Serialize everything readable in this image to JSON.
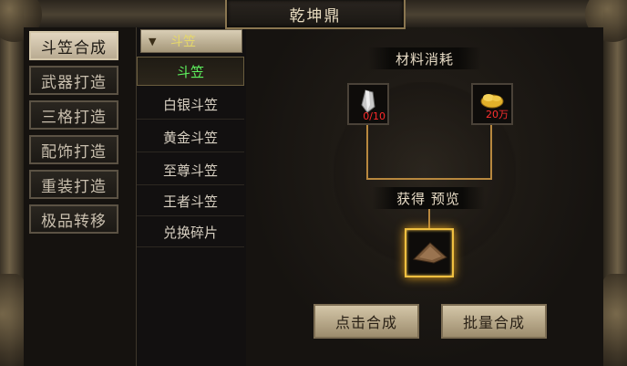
{
  "window": {
    "title": "乾坤鼎"
  },
  "side_tabs": [
    {
      "label": "斗笠合成",
      "active": true
    },
    {
      "label": "武器打造",
      "active": false
    },
    {
      "label": "三格打造",
      "active": false
    },
    {
      "label": "配饰打造",
      "active": false
    },
    {
      "label": "重装打造",
      "active": false
    },
    {
      "label": "极品转移",
      "active": false
    }
  ],
  "list": {
    "header": {
      "arrow": "▼",
      "label": "斗笠"
    },
    "items": [
      {
        "label": "斗笠",
        "selected": true
      },
      {
        "label": "白银斗笠",
        "selected": false
      },
      {
        "label": "黄金斗笠",
        "selected": false
      },
      {
        "label": "至尊斗笠",
        "selected": false
      },
      {
        "label": "王者斗笠",
        "selected": false
      },
      {
        "label": "兑换碎片",
        "selected": false
      }
    ]
  },
  "materials": {
    "title": "材料消耗",
    "slots": [
      {
        "icon": "crystal-shard-icon",
        "count": "0/10"
      },
      {
        "icon": "gold-coins-icon",
        "count": "20万"
      }
    ]
  },
  "preview": {
    "title": "获得 预览",
    "icon": "hat-icon"
  },
  "buttons": {
    "compose": "点击合成",
    "batch": "批量合成"
  },
  "colors": {
    "selected_item": "#5ef25e",
    "header_label": "#e6d86a",
    "count_red": "#ff2a2a",
    "result_glow": "#f0c040"
  }
}
